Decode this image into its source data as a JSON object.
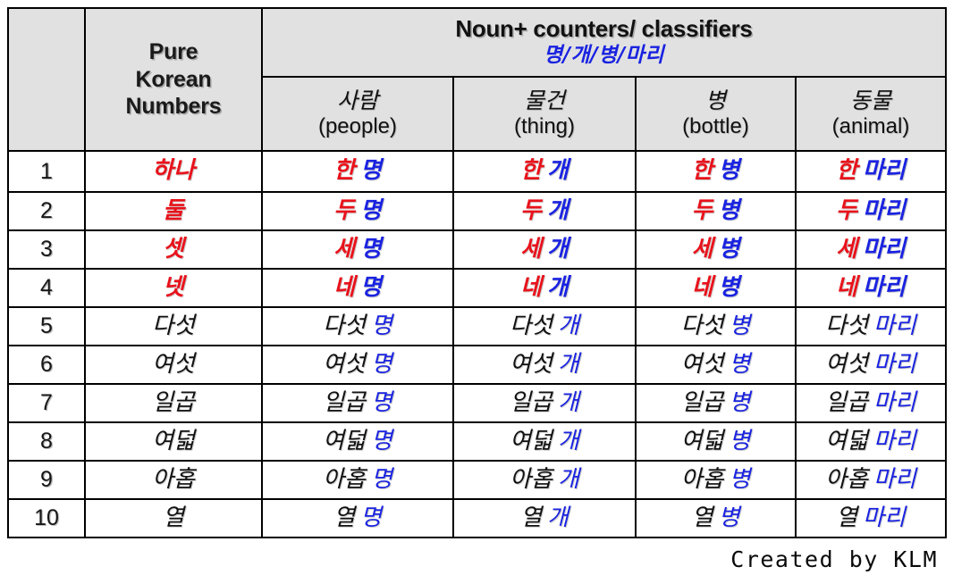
{
  "table": {
    "headers": {
      "index_column": "",
      "pure_korean_numbers": [
        "Pure",
        "Korean",
        "Numbers"
      ],
      "noun_counters_title": "Noun+ counters/ classifiers",
      "noun_counters_korean": "명/개/병/마리",
      "subcolumns": [
        {
          "korean": "사람",
          "english": "(people)",
          "counter": "명"
        },
        {
          "korean": "물건",
          "english": "(thing)",
          "counter": "개"
        },
        {
          "korean": "병",
          "english": "(bottle)",
          "counter": "병"
        },
        {
          "korean": "동물",
          "english": "(animal)",
          "counter": "마리"
        }
      ]
    },
    "rows": [
      {
        "index": "1",
        "pure": "하나",
        "pure_color": "red",
        "people_num": "한",
        "people_ctr": "명",
        "thing_num": "한",
        "thing_ctr": "개",
        "bottle_num": "한",
        "bottle_ctr": "병",
        "animal_num": "한",
        "animal_ctr": "마리"
      },
      {
        "index": "2",
        "pure": "둘",
        "pure_color": "red",
        "people_num": "두",
        "people_ctr": "명",
        "thing_num": "두",
        "thing_ctr": "개",
        "bottle_num": "두",
        "bottle_ctr": "병",
        "animal_num": "두",
        "animal_ctr": "마리"
      },
      {
        "index": "3",
        "pure": "셋",
        "pure_color": "red",
        "people_num": "세",
        "people_ctr": "명",
        "thing_num": "세",
        "thing_ctr": "개",
        "bottle_num": "세",
        "bottle_ctr": "병",
        "animal_num": "세",
        "animal_ctr": "마리"
      },
      {
        "index": "4",
        "pure": "넷",
        "pure_color": "red",
        "people_num": "네",
        "people_ctr": "명",
        "thing_num": "네",
        "thing_ctr": "개",
        "bottle_num": "네",
        "bottle_ctr": "병",
        "animal_num": "네",
        "animal_ctr": "마리"
      },
      {
        "index": "5",
        "pure": "다섯",
        "pure_color": "black",
        "people_num": "다섯",
        "people_ctr": "명",
        "thing_num": "다섯",
        "thing_ctr": "개",
        "bottle_num": "다섯",
        "bottle_ctr": "병",
        "animal_num": "다섯",
        "animal_ctr": "마리"
      },
      {
        "index": "6",
        "pure": "여섯",
        "pure_color": "black",
        "people_num": "여섯",
        "people_ctr": "명",
        "thing_num": "여섯",
        "thing_ctr": "개",
        "bottle_num": "여섯",
        "bottle_ctr": "병",
        "animal_num": "여섯",
        "animal_ctr": "마리"
      },
      {
        "index": "7",
        "pure": "일곱",
        "pure_color": "black",
        "people_num": "일곱",
        "people_ctr": "명",
        "thing_num": "일곱",
        "thing_ctr": "개",
        "bottle_num": "일곱",
        "bottle_ctr": "병",
        "animal_num": "일곱",
        "animal_ctr": "마리"
      },
      {
        "index": "8",
        "pure": "여덟",
        "pure_color": "black",
        "people_num": "여덟",
        "people_ctr": "명",
        "thing_num": "여덟",
        "thing_ctr": "개",
        "bottle_num": "여덟",
        "bottle_ctr": "병",
        "animal_num": "여덟",
        "animal_ctr": "마리"
      },
      {
        "index": "9",
        "pure": "아홉",
        "pure_color": "black",
        "people_num": "아홉",
        "people_ctr": "명",
        "thing_num": "아홉",
        "thing_ctr": "개",
        "bottle_num": "아홉",
        "bottle_ctr": "병",
        "animal_num": "아홉",
        "animal_ctr": "마리"
      },
      {
        "index": "10",
        "pure": "열",
        "pure_color": "black",
        "people_num": "열",
        "people_ctr": "명",
        "thing_num": "열",
        "thing_ctr": "개",
        "bottle_num": "열",
        "bottle_ctr": "병",
        "animal_num": "열",
        "animal_ctr": "마리"
      }
    ]
  },
  "footer": {
    "credit": "Created by KLM"
  },
  "colors": {
    "number_red": "#e8121b",
    "counter_blue": "#1a23e0",
    "text_black": "#111111",
    "header_background": "#e1e1e1",
    "border": "#000000",
    "page_background": "#ffffff"
  }
}
